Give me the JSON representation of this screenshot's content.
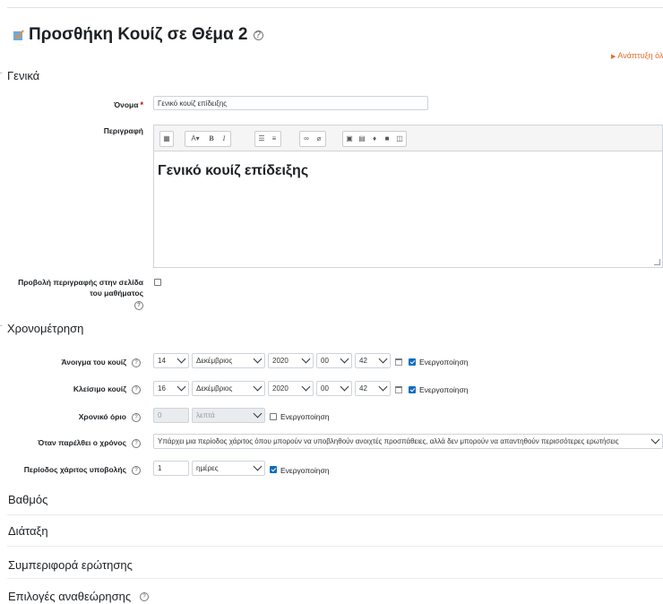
{
  "page": {
    "title": "Προσθήκη Κουίζ σε Θέμα 2",
    "expand_all": "Ανάπτυξη όλω"
  },
  "general": {
    "heading": "Γενικά",
    "name_label": "Όνομα",
    "name_value": "Γενικό κουίζ επίδειξης",
    "description_label": "Περιγραφή",
    "description_text": "Γενικό κουίζ επίδειξης",
    "show_description_label_line1": "Προβολή περιγραφής στην σελίδα",
    "show_description_label_line2": "του μαθήματος"
  },
  "timing": {
    "heading": "Χρονομέτρηση",
    "open_label": "Άνοιγμα του κουίζ",
    "open": {
      "day": "14",
      "month": "Δεκέμβριος",
      "year": "2020",
      "hour": "00",
      "minute": "42",
      "enable": "Ενεργοποίηση"
    },
    "close_label": "Κλείσιμο κουίζ",
    "close": {
      "day": "16",
      "month": "Δεκέμβριος",
      "year": "2020",
      "hour": "00",
      "minute": "42",
      "enable": "Ενεργοποίηση"
    },
    "time_limit_label": "Χρονικό όριο",
    "time_limit_value": "0",
    "time_limit_unit": "λεπτά",
    "time_limit_enable": "Ενεργοποίηση",
    "when_expires_label": "Όταν παρέλθει ο χρόνος",
    "when_expires_value": "Υπάρχει μια περίοδος χάριτος όπου μπορούν να υποβληθούν ανοιχτές προσπάθειες, αλλά δεν μπορούν να απαντηθούν περισσότερες ερωτήσεις",
    "grace_label": "Περίοδος χάριτος υποβολής",
    "grace_value": "1",
    "grace_unit": "ημέρες",
    "grace_enable": "Ενεργοποίηση"
  },
  "sections": {
    "grade": "Βαθμός",
    "layout": "Διάταξη",
    "question_behaviour": "Συμπεριφορά ερώτησης",
    "review_options": "Επιλογές αναθεώρησης"
  },
  "colors": {
    "accent": "#0f6cbf",
    "link": "#e86b28",
    "required": "#cc0000"
  },
  "toolbar_icons": [
    "toolbar-toggle-icon",
    "font-style-icon",
    "bold-icon",
    "italic-icon",
    "unordered-list-icon",
    "ordered-list-icon",
    "link-icon",
    "unlink-icon",
    "image-icon",
    "media-icon",
    "audio-record-icon",
    "video-record-icon",
    "manage-files-icon"
  ]
}
